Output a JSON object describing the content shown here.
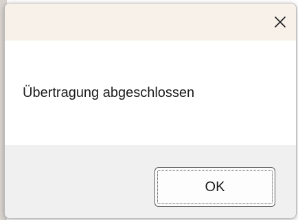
{
  "dialog": {
    "message": "Übertragung abgeschlossen",
    "ok_label": "OK"
  },
  "icons": {
    "close": "close-icon"
  },
  "colors": {
    "titlebar_bg": "#f7f1ea",
    "footer_bg": "#f0f0f0",
    "button_border": "#5a5a5a"
  }
}
